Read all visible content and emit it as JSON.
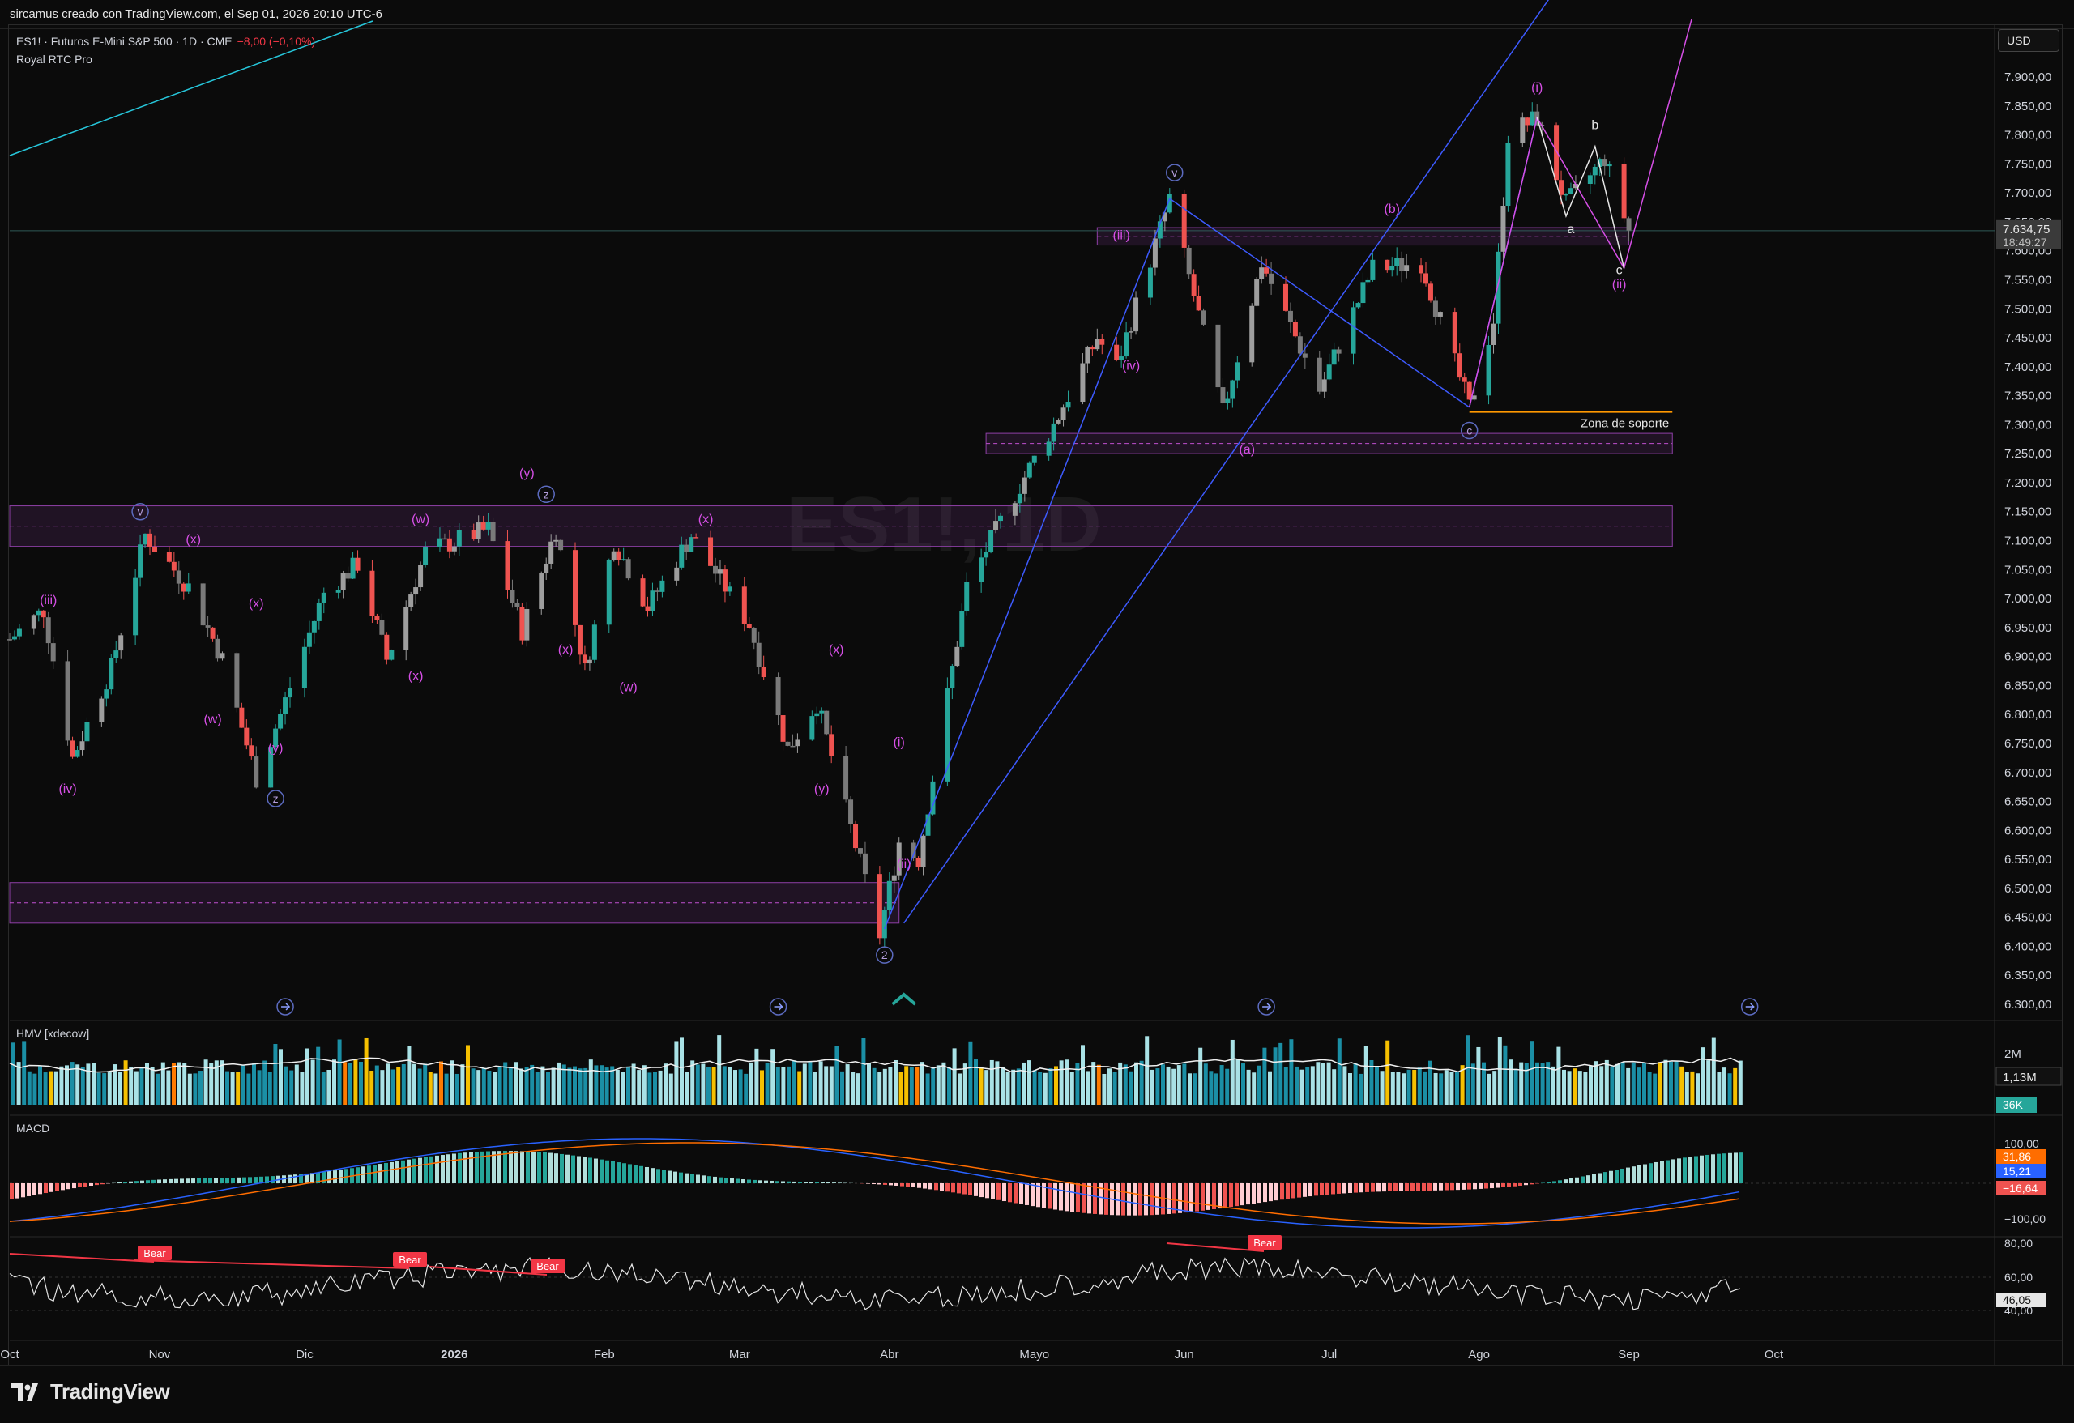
{
  "header": {
    "credit": "sircamus creado con TradingView.com, el Sep 01, 2026 20:10 UTC-6"
  },
  "legend": {
    "symbol": "ES1! · Futuros E-Mini S&P 500 · 1D · CME",
    "change": "−8,00 (−0,10%)",
    "indicator": "Royal RTC Pro"
  },
  "currency_button": "USD",
  "watermark": "ES1!, 1D",
  "brand": "TradingView",
  "colors": {
    "bull": "#26a69a",
    "bear": "#ef5350",
    "wave": "#d64fe6",
    "blue": "#3d5afe",
    "zone": "#8e3fa6"
  },
  "chart_data": [
    {
      "type": "candlestick",
      "title": "",
      "ylim": [
        6280,
        7980
      ],
      "y_ticks": [
        "7.900,00",
        "7.850,00",
        "7.800,00",
        "7.750,00",
        "7.700,00",
        "7.650,00",
        "7.600,00",
        "7.550,00",
        "7.500,00",
        "7.450,00",
        "7.400,00",
        "7.350,00",
        "7.300,00",
        "7.250,00",
        "7.200,00",
        "7.150,00",
        "7.100,00",
        "7.050,00",
        "7.000,00",
        "6.950,00",
        "6.900,00",
        "6.850,00",
        "6.800,00",
        "6.750,00",
        "6.700,00",
        "6.650,00",
        "6.600,00",
        "6.550,00",
        "6.500,00",
        "6.450,00",
        "6.400,00",
        "6.350,00",
        "6.300,00"
      ],
      "y_tick_values": [
        7900,
        7850,
        7800,
        7750,
        7700,
        7650,
        7600,
        7550,
        7500,
        7450,
        7400,
        7350,
        7300,
        7250,
        7200,
        7150,
        7100,
        7050,
        7000,
        6950,
        6900,
        6850,
        6800,
        6750,
        6700,
        6650,
        6600,
        6550,
        6500,
        6450,
        6400,
        6350,
        6300
      ],
      "last_price": "7.634,75",
      "countdown": "18:49:27",
      "last_value": 7634.75,
      "x_ticks": [
        "Oct",
        "Nov",
        "Dic",
        "2026",
        "Feb",
        "Mar",
        "Abr",
        "Mayo",
        "Jun",
        "Jul",
        "Ago",
        "Sep",
        "Oct"
      ],
      "x_tick_dates": [
        "2025-10-01",
        "2025-11-01",
        "2025-12-01",
        "2026-01-01",
        "2026-02-01",
        "2026-03-01",
        "2026-04-01",
        "2026-05-01",
        "2026-06-01",
        "2026-07-01",
        "2026-08-01",
        "2026-09-01",
        "2026-10-01"
      ],
      "x_range": [
        "2025-10-01",
        "2026-11-15"
      ],
      "path": [
        [
          "2025-10-01",
          6930
        ],
        [
          "2025-10-08",
          6980
        ],
        [
          "2025-10-14",
          6725
        ],
        [
          "2025-10-22",
          6880
        ],
        [
          "2025-10-29",
          7110
        ],
        [
          "2025-11-07",
          7020
        ],
        [
          "2025-11-14",
          6895
        ],
        [
          "2025-11-21",
          6690
        ],
        [
          "2025-11-26",
          6800
        ],
        [
          "2025-12-05",
          7010
        ],
        [
          "2025-12-12",
          7060
        ],
        [
          "2025-12-18",
          6895
        ],
        [
          "2025-12-26",
          7080
        ],
        [
          "2026-01-08",
          7120
        ],
        [
          "2026-01-15",
          6945
        ],
        [
          "2026-01-22",
          7120
        ],
        [
          "2026-01-28",
          6875
        ],
        [
          "2026-02-03",
          7100
        ],
        [
          "2026-02-10",
          6985
        ],
        [
          "2026-02-19",
          7110
        ],
        [
          "2026-03-03",
          6955
        ],
        [
          "2026-03-11",
          6740
        ],
        [
          "2026-03-17",
          6820
        ],
        [
          "2026-03-30",
          6420
        ],
        [
          "2026-04-03",
          6580
        ],
        [
          "2026-04-07",
          6550
        ],
        [
          "2026-04-17",
          7020
        ],
        [
          "2026-04-27",
          7180
        ],
        [
          "2026-05-05",
          7300
        ],
        [
          "2026-05-14",
          7450
        ],
        [
          "2026-05-18",
          7400
        ],
        [
          "2026-05-29",
          7690
        ],
        [
          "2026-06-09",
          7320
        ],
        [
          "2026-06-17",
          7580
        ],
        [
          "2026-06-29",
          7360
        ],
        [
          "2026-07-10",
          7570
        ],
        [
          "2026-07-20",
          7580
        ],
        [
          "2026-07-30",
          7330
        ],
        [
          "2026-08-04",
          7480
        ],
        [
          "2026-08-07",
          7800
        ],
        [
          "2026-08-13",
          7830
        ],
        [
          "2026-08-19",
          7680
        ],
        [
          "2026-08-27",
          7760
        ],
        [
          "2026-09-01",
          7635
        ]
      ],
      "zones": [
        {
          "top": 7160,
          "bottom": 7090,
          "from": "2025-10-01",
          "to": "2026-09-10"
        },
        {
          "top": 7285,
          "bottom": 7250,
          "from": "2026-04-21",
          "to": "2026-09-10"
        },
        {
          "top": 7640,
          "bottom": 7610,
          "from": "2026-05-14",
          "to": "2026-09-01"
        },
        {
          "top": 6510,
          "bottom": 6440,
          "from": "2025-10-01",
          "to": "2026-04-03"
        }
      ],
      "support": {
        "label": "Zona de soporte",
        "value": 7322,
        "from": "2026-07-30",
        "to": "2026-09-10"
      },
      "wave_labels": [
        {
          "t": "(iii)",
          "d": "2025-10-09",
          "v": 6990
        },
        {
          "t": "(iv)",
          "d": "2025-10-13",
          "v": 6665
        },
        {
          "t": "(x)",
          "d": "2025-11-08",
          "v": 7095
        },
        {
          "t": "(w)",
          "d": "2025-11-12",
          "v": 6785
        },
        {
          "t": "(x)",
          "d": "2025-11-21",
          "v": 6985
        },
        {
          "t": "(y)",
          "d": "2025-11-25",
          "v": 6735
        },
        {
          "t": "(w)",
          "d": "2025-12-25",
          "v": 7130
        },
        {
          "t": "(x)",
          "d": "2025-12-24",
          "v": 6860
        },
        {
          "t": "(y)",
          "d": "2026-01-16",
          "v": 7210
        },
        {
          "t": "(x)",
          "d": "2026-01-24",
          "v": 6905
        },
        {
          "t": "(w)",
          "d": "2026-02-06",
          "v": 6840
        },
        {
          "t": "(x)",
          "d": "2026-02-22",
          "v": 7130
        },
        {
          "t": "(x)",
          "d": "2026-03-21",
          "v": 6905
        },
        {
          "t": "(y)",
          "d": "2026-03-18",
          "v": 6665
        },
        {
          "t": "(i)",
          "d": "2026-04-03",
          "v": 6745
        },
        {
          "t": "(ii)",
          "d": "2026-04-04",
          "v": 6535
        },
        {
          "t": "(iii)",
          "d": "2026-05-19",
          "v": 7620
        },
        {
          "t": "(iv)",
          "d": "2026-05-21",
          "v": 7395
        },
        {
          "t": "(a)",
          "d": "2026-06-14",
          "v": 7250
        },
        {
          "t": "(b)",
          "d": "2026-07-14",
          "v": 7665
        },
        {
          "t": "(i)",
          "d": "2026-08-13",
          "v": 7875
        },
        {
          "t": "(ii)",
          "d": "2026-08-30",
          "v": 7535
        }
      ],
      "circle_labels": [
        {
          "t": "v",
          "d": "2025-10-28",
          "v": 7150
        },
        {
          "t": "z",
          "d": "2026-01-20",
          "v": 7180
        },
        {
          "t": "z",
          "d": "2025-11-25",
          "v": 6655
        },
        {
          "t": "2",
          "d": "2026-03-31",
          "v": 6385
        },
        {
          "t": "v",
          "d": "2026-05-30",
          "v": 7735
        },
        {
          "t": "c",
          "d": "2026-07-30",
          "v": 7290
        }
      ],
      "minor_labels": [
        {
          "t": "b",
          "d": "2026-08-25",
          "v": 7810
        },
        {
          "t": "a",
          "d": "2026-08-20",
          "v": 7630
        },
        {
          "t": "c",
          "d": "2026-08-30",
          "v": 7560
        }
      ],
      "time_markers": [
        "2025-11-27",
        "2026-03-09",
        "2026-06-18",
        "2026-09-26"
      ]
    },
    {
      "type": "bar",
      "title": "HMV [xdecow]",
      "y_ticks": [
        "2M"
      ],
      "last_value": "1,13M",
      "secondary_value": "36K"
    },
    {
      "type": "line",
      "title": "MACD",
      "y_ticks": [
        "100,00",
        "−100,00"
      ],
      "values": {
        "macd": "31,86",
        "signal": "15,21",
        "hist": "−16,64"
      }
    },
    {
      "type": "line",
      "y_ticks": [
        "80,00",
        "60,00",
        "40,00"
      ],
      "last_value": "46,05",
      "divergence_labels": [
        "Bear",
        "Bear",
        "Bear",
        "Bear"
      ]
    }
  ]
}
